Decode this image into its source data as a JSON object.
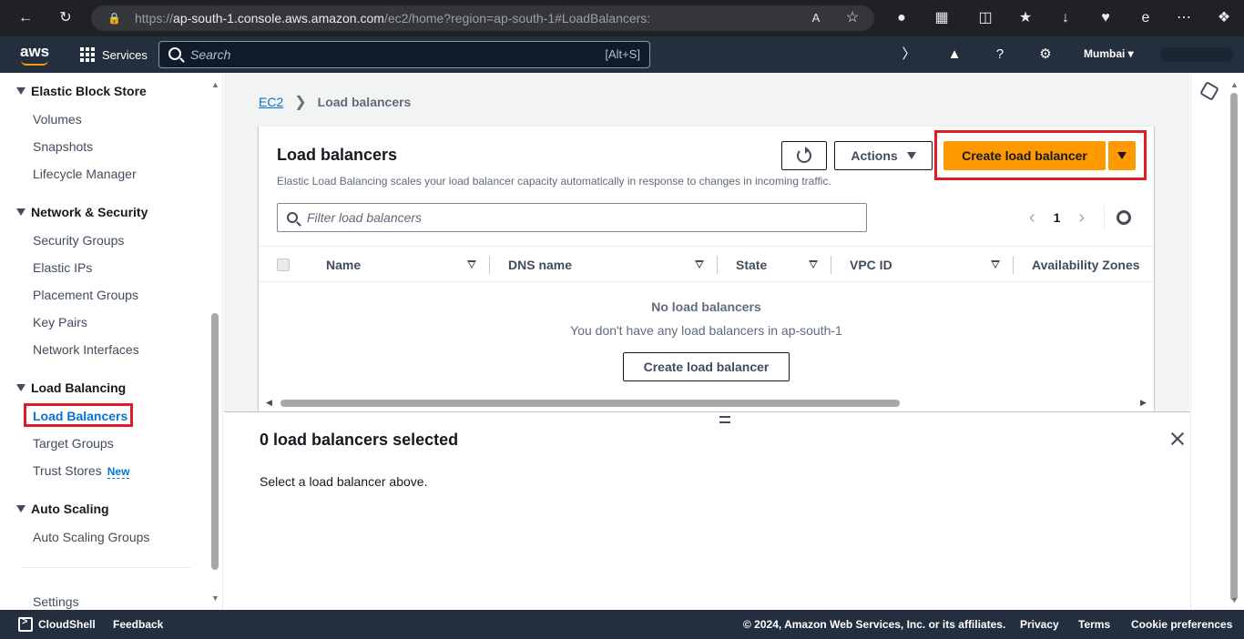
{
  "browser": {
    "url_prefix": "https://",
    "url_host": "ap-south-1.console.aws.amazon.com",
    "url_path": "/ec2/home?region=ap-south-1#LoadBalancers:"
  },
  "topnav": {
    "logo": "aws",
    "services_label": "Services",
    "search_placeholder": "Search",
    "search_shortcut": "[Alt+S]",
    "region": "Mumbai"
  },
  "sidebar": {
    "sections": [
      {
        "title": "Elastic Block Store",
        "items": [
          "Volumes",
          "Snapshots",
          "Lifecycle Manager"
        ]
      },
      {
        "title": "Network & Security",
        "items": [
          "Security Groups",
          "Elastic IPs",
          "Placement Groups",
          "Key Pairs",
          "Network Interfaces"
        ]
      },
      {
        "title": "Load Balancing",
        "items": [
          "Load Balancers",
          "Target Groups",
          "Trust Stores"
        ]
      },
      {
        "title": "Auto Scaling",
        "items": [
          "Auto Scaling Groups"
        ]
      }
    ],
    "new_badge": "New",
    "settings": "Settings"
  },
  "breadcrumb": {
    "root": "EC2",
    "current": "Load balancers"
  },
  "panel": {
    "title": "Load balancers",
    "description": "Elastic Load Balancing scales your load balancer capacity automatically in response to changes in incoming traffic.",
    "actions_label": "Actions",
    "create_label": "Create load balancer",
    "filter_placeholder": "Filter load balancers",
    "page_number": "1",
    "columns": [
      "Name",
      "DNS name",
      "State",
      "VPC ID",
      "Availability Zones"
    ],
    "empty_title": "No load balancers",
    "empty_desc": "You don't have any load balancers in ap-south-1",
    "empty_create_label": "Create load balancer"
  },
  "split_panel": {
    "title": "0 load balancers selected",
    "message": "Select a load balancer above."
  },
  "footer": {
    "cloudshell": "CloudShell",
    "feedback": "Feedback",
    "copyright": "© 2024, Amazon Web Services, Inc. or its affiliates.",
    "privacy": "Privacy",
    "terms": "Terms",
    "cookies": "Cookie preferences"
  },
  "colors": {
    "accent": "#ff9900",
    "highlight": "#e01b24",
    "link": "#0972d3",
    "nav_bg": "#232f3e"
  }
}
